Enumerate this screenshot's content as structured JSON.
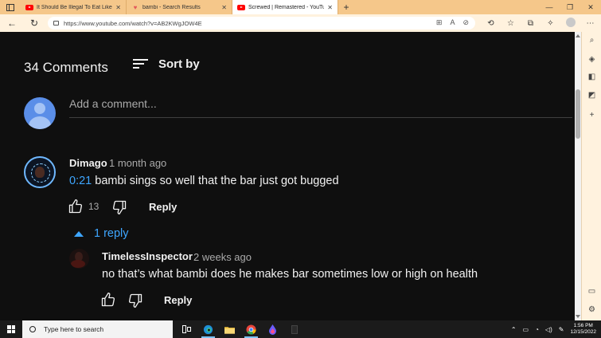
{
  "browser": {
    "tabs": [
      {
        "title": "It Should Be Illegal To Eat Like Th",
        "favicon": "youtube-icon",
        "active": false
      },
      {
        "title": "bambi - Search Results",
        "favicon": "heart-icon",
        "active": false
      },
      {
        "title": "Screwed | Remastered - YouTube",
        "favicon": "youtube-icon",
        "active": true
      }
    ],
    "url": "https://www.youtube.com/watch?v=AB2KWgJOW4E"
  },
  "comments_section": {
    "count_label": "34 Comments",
    "sort_label": "Sort by",
    "add_placeholder": "Add a comment...",
    "comment": {
      "author": "Dimago",
      "time": "1 month ago",
      "timestamp_link": "0:21",
      "text": " bambi sings so well that the bar just got bugged",
      "likes": "13",
      "reply_label": "Reply",
      "replies_toggle": "1 reply"
    },
    "reply": {
      "author": "TimelessInspector",
      "time": "2 weeks ago",
      "text": "no that’s what bambi does he makes bar sometimes low or high on health",
      "reply_label": "Reply"
    }
  },
  "taskbar": {
    "search_placeholder": "Type here to search",
    "time": "1:56 PM",
    "date": "12/15/2022"
  },
  "colors": {
    "page_bg": "#0f0f0f",
    "link_blue": "#3ea6ff",
    "tab_strip": "#f5c78a",
    "toolbar": "#fff2de"
  }
}
